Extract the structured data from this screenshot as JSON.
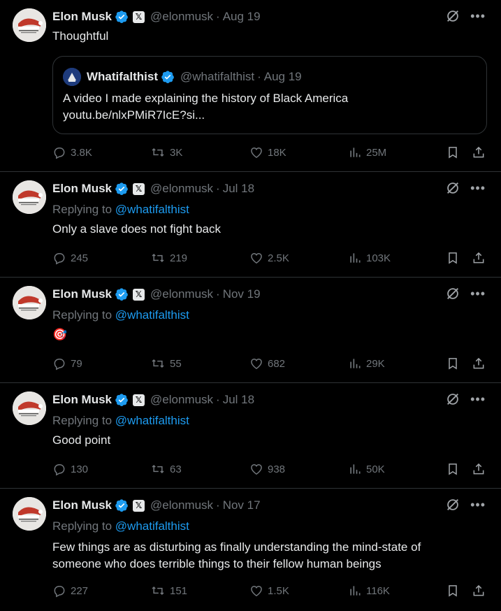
{
  "colors": {
    "background": "#000000",
    "text": "#e7e9ea",
    "muted": "#71767b",
    "accent": "#1d9bf0",
    "border": "#2f3336"
  },
  "tweets": [
    {
      "author_name": "Elon Musk",
      "x_badge": "𝕏",
      "handle": "@elonmusk",
      "date": "Aug 19",
      "reply_prefix": "",
      "reply_handle": "",
      "text": "Thoughtful",
      "quote": {
        "author_name": "Whatifalthist",
        "handle": "@whatifalthist",
        "date": "Aug 19",
        "line1": "A video I made explaining the history of Black America",
        "line2": "youtu.be/nlxPMiR7IcE?si..."
      },
      "stats": {
        "replies": "3.8K",
        "retweets": "3K",
        "likes": "18K",
        "views": "25M"
      }
    },
    {
      "author_name": "Elon Musk",
      "x_badge": "𝕏",
      "handle": "@elonmusk",
      "date": "Jul 18",
      "reply_prefix": "Replying to ",
      "reply_handle": "@whatifalthist",
      "text": "Only a slave does not fight back",
      "stats": {
        "replies": "245",
        "retweets": "219",
        "likes": "2.5K",
        "views": "103K"
      }
    },
    {
      "author_name": "Elon Musk",
      "x_badge": "𝕏",
      "handle": "@elonmusk",
      "date": "Nov 19",
      "reply_prefix": "Replying to ",
      "reply_handle": "@whatifalthist",
      "text": "🎯",
      "stats": {
        "replies": "79",
        "retweets": "55",
        "likes": "682",
        "views": "29K"
      }
    },
    {
      "author_name": "Elon Musk",
      "x_badge": "𝕏",
      "handle": "@elonmusk",
      "date": "Jul 18",
      "reply_prefix": "Replying to ",
      "reply_handle": "@whatifalthist",
      "text": "Good point",
      "stats": {
        "replies": "130",
        "retweets": "63",
        "likes": "938",
        "views": "50K"
      }
    },
    {
      "author_name": "Elon Musk",
      "x_badge": "𝕏",
      "handle": "@elonmusk",
      "date": "Nov 17",
      "reply_prefix": "Replying to ",
      "reply_handle": "@whatifalthist",
      "text": "Few things are as disturbing as finally understanding the mind-state of\nsomeone who does terrible things to their fellow human beings",
      "stats": {
        "replies": "227",
        "retweets": "151",
        "likes": "1.5K",
        "views": "116K"
      }
    }
  ],
  "icons": {
    "reply": "reply-icon",
    "retweet": "retweet-icon",
    "like": "heart-icon",
    "views": "views-icon",
    "bookmark": "bookmark-icon",
    "share": "share-icon",
    "grok": "grok-icon",
    "more": "more-icon",
    "verified": "verified-badge-icon"
  }
}
